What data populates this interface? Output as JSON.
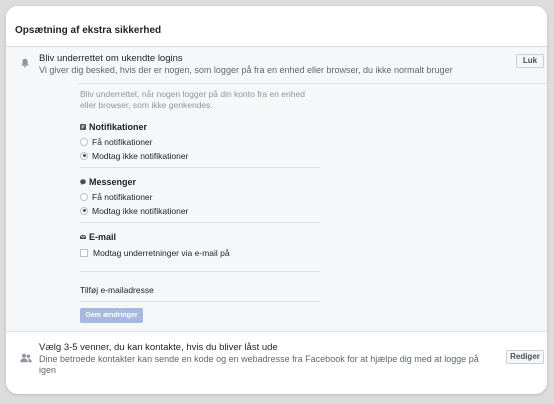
{
  "header": {
    "title": "Opsætning af ekstra sikkerhed"
  },
  "login_alerts": {
    "title": "Bliv underrettet om ukendte logins",
    "subtitle": "Vi giver dig besked, hvis der er nogen, som logger på fra en enhed eller browser, du ikke normalt bruger",
    "close_label": "Luk",
    "description": "Bliv underrettet, når nogen logger på din konto fra en enhed eller browser, som ikke genkendes.",
    "notifications": {
      "title": "Notifikationer",
      "option_on": "Få notifikationer",
      "option_off": "Modtag ikke notifikationer",
      "selected": "option_off"
    },
    "messenger": {
      "title": "Messenger",
      "option_on": "Få notifikationer",
      "option_off": "Modtag ikke notifikationer",
      "selected": "option_off"
    },
    "email": {
      "title": "E-mail",
      "checkbox_label": "Modtag underretninger via e-mail på",
      "checked": false
    },
    "add_email_label": "Tilføj e-mailadresse",
    "save_label": "Gem ændringer"
  },
  "trusted_contacts": {
    "title": "Vælg 3-5 venner, du kan kontakte, hvis du bliver låst ude",
    "subtitle": "Dine betroede kontakter kan sende en kode og en webadresse fra Facebook for at hjælpe dig med at logge på igen",
    "edit_label": "Rediger"
  },
  "icons": {
    "bell": "bell-icon",
    "notifications": "notification-icon",
    "messenger": "messenger-icon",
    "friends": "friends-icon"
  },
  "colors": {
    "save_button_disabled": "#a7b8de",
    "panel_background": "#f6f7f9",
    "muted_text": "#90949c"
  }
}
